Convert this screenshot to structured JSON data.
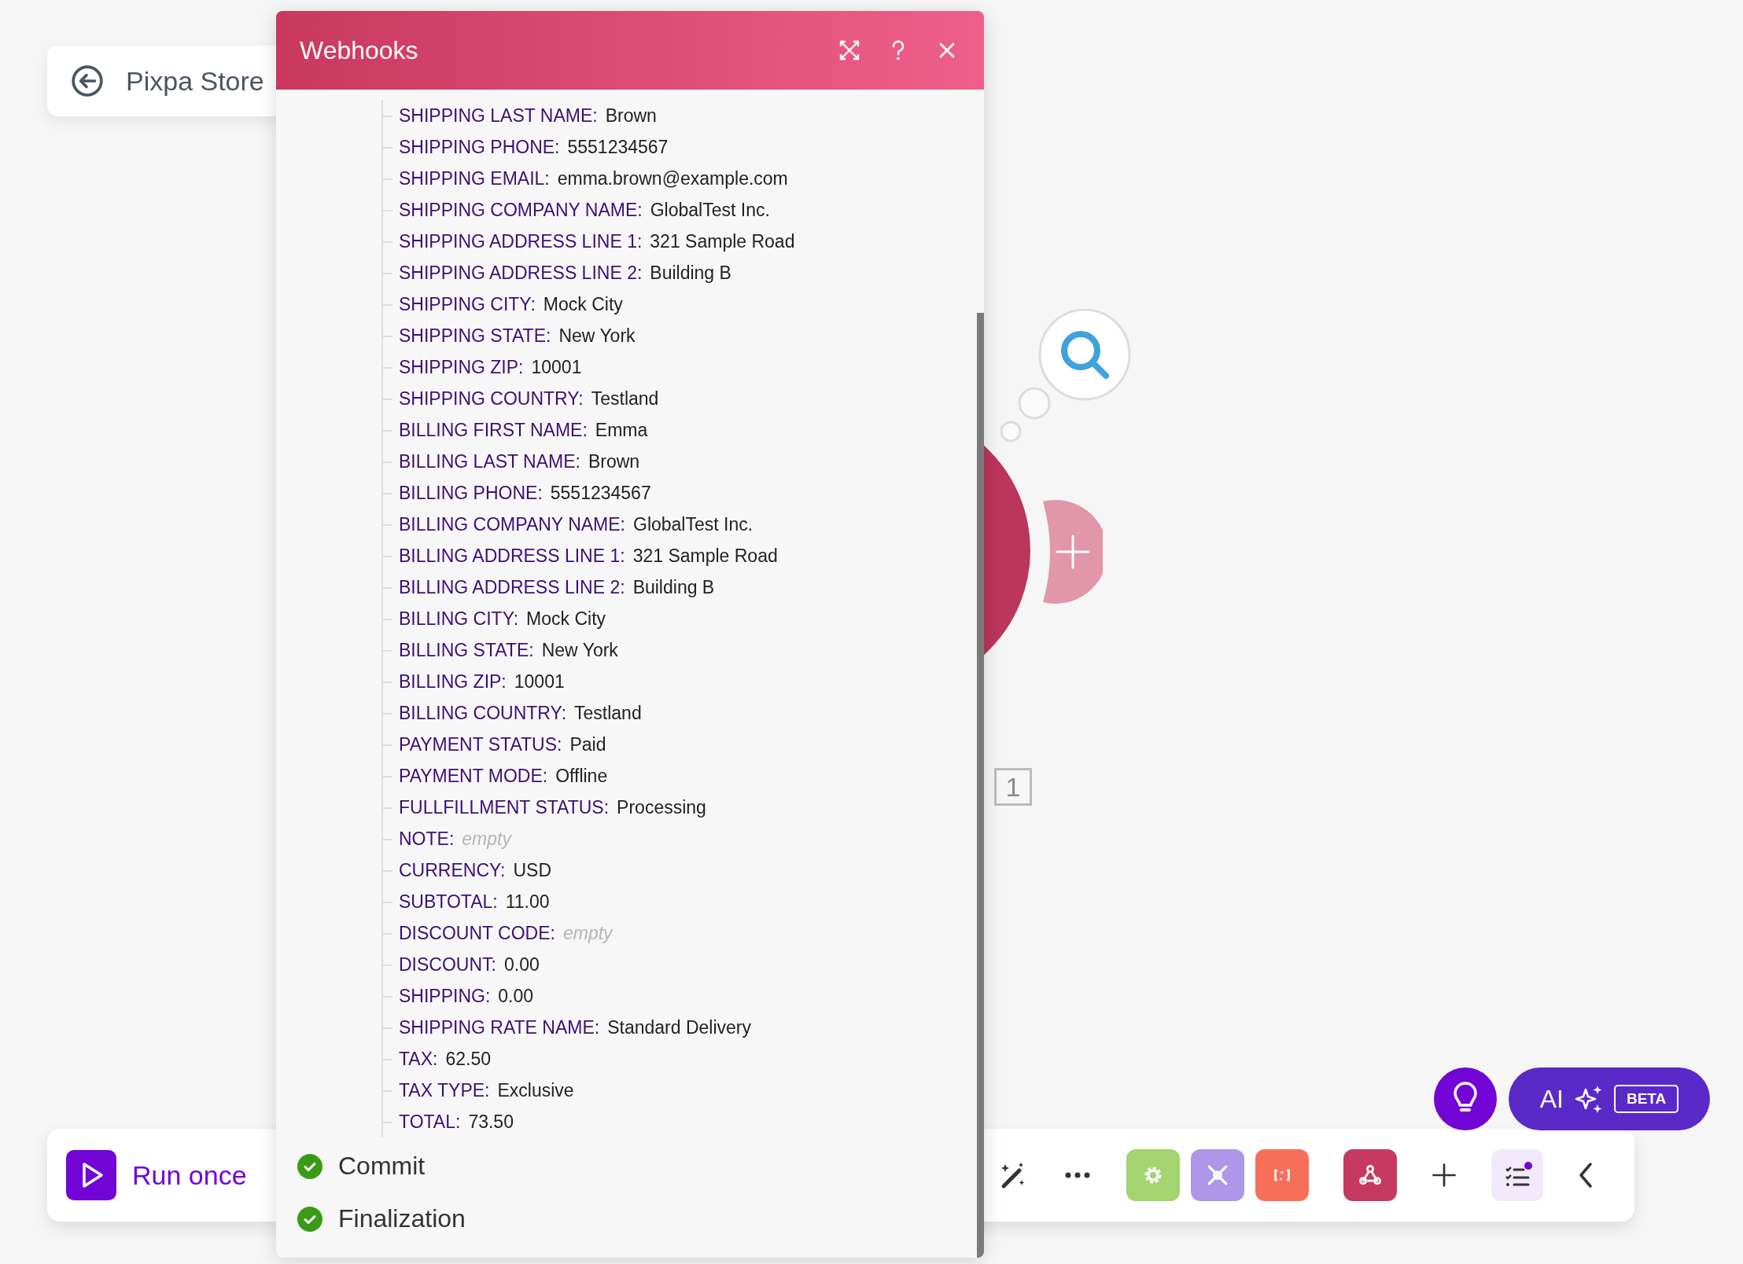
{
  "scenario": {
    "title": "Pixpa Store"
  },
  "panel": {
    "title": "Webhooks",
    "fields": [
      {
        "key": "SHIPPING LAST NAME:",
        "value": "Brown",
        "empty": false
      },
      {
        "key": "SHIPPING PHONE:",
        "value": "5551234567",
        "empty": false
      },
      {
        "key": "SHIPPING EMAIL:",
        "value": "emma.brown@example.com",
        "empty": false
      },
      {
        "key": "SHIPPING COMPANY NAME:",
        "value": "GlobalTest Inc.",
        "empty": false
      },
      {
        "key": "SHIPPING ADDRESS LINE 1:",
        "value": "321 Sample Road",
        "empty": false
      },
      {
        "key": "SHIPPING ADDRESS LINE 2:",
        "value": "Building B",
        "empty": false
      },
      {
        "key": "SHIPPING CITY:",
        "value": "Mock City",
        "empty": false
      },
      {
        "key": "SHIPPING STATE:",
        "value": "New York",
        "empty": false
      },
      {
        "key": "SHIPPING ZIP:",
        "value": "10001",
        "empty": false
      },
      {
        "key": "SHIPPING COUNTRY:",
        "value": "Testland",
        "empty": false
      },
      {
        "key": "BILLING FIRST NAME:",
        "value": "Emma",
        "empty": false
      },
      {
        "key": "BILLING LAST NAME:",
        "value": "Brown",
        "empty": false
      },
      {
        "key": "BILLING PHONE:",
        "value": "5551234567",
        "empty": false
      },
      {
        "key": "BILLING COMPANY NAME:",
        "value": "GlobalTest Inc.",
        "empty": false
      },
      {
        "key": "BILLING ADDRESS LINE 1:",
        "value": "321 Sample Road",
        "empty": false
      },
      {
        "key": "BILLING ADDRESS LINE 2:",
        "value": "Building B",
        "empty": false
      },
      {
        "key": "BILLING CITY:",
        "value": "Mock City",
        "empty": false
      },
      {
        "key": "BILLING STATE:",
        "value": "New York",
        "empty": false
      },
      {
        "key": "BILLING ZIP:",
        "value": "10001",
        "empty": false
      },
      {
        "key": "BILLING COUNTRY:",
        "value": "Testland",
        "empty": false
      },
      {
        "key": "PAYMENT STATUS:",
        "value": "Paid",
        "empty": false
      },
      {
        "key": "PAYMENT MODE:",
        "value": "Offline",
        "empty": false
      },
      {
        "key": "FULLFILLMENT STATUS:",
        "value": "Processing",
        "empty": false
      },
      {
        "key": "NOTE:",
        "value": "empty",
        "empty": true
      },
      {
        "key": "CURRENCY:",
        "value": "USD",
        "empty": false
      },
      {
        "key": "SUBTOTAL:",
        "value": "11.00",
        "empty": false
      },
      {
        "key": "DISCOUNT CODE:",
        "value": "empty",
        "empty": true
      },
      {
        "key": "DISCOUNT:",
        "value": "0.00",
        "empty": false
      },
      {
        "key": "SHIPPING:",
        "value": "0.00",
        "empty": false
      },
      {
        "key": "SHIPPING RATE NAME:",
        "value": "Standard Delivery",
        "empty": false
      },
      {
        "key": "TAX:",
        "value": "62.50",
        "empty": false
      },
      {
        "key": "TAX TYPE:",
        "value": "Exclusive",
        "empty": false
      },
      {
        "key": "TOTAL:",
        "value": "73.50",
        "empty": false
      }
    ],
    "steps": [
      {
        "label": "Commit",
        "done": true
      },
      {
        "label": "Finalization",
        "done": true
      }
    ]
  },
  "node": {
    "badge": "1"
  },
  "toolbar": {
    "run_label": "Run once",
    "tools": [
      {
        "kind": "gear",
        "color": "#a2d46f"
      },
      {
        "kind": "tools",
        "color": "#ae97e8"
      },
      {
        "kind": "brackets",
        "color": "#f86f59"
      },
      {
        "kind": "webhook",
        "color": "#c63a61"
      }
    ]
  },
  "ai": {
    "label": "AI",
    "badge": "BETA"
  }
}
